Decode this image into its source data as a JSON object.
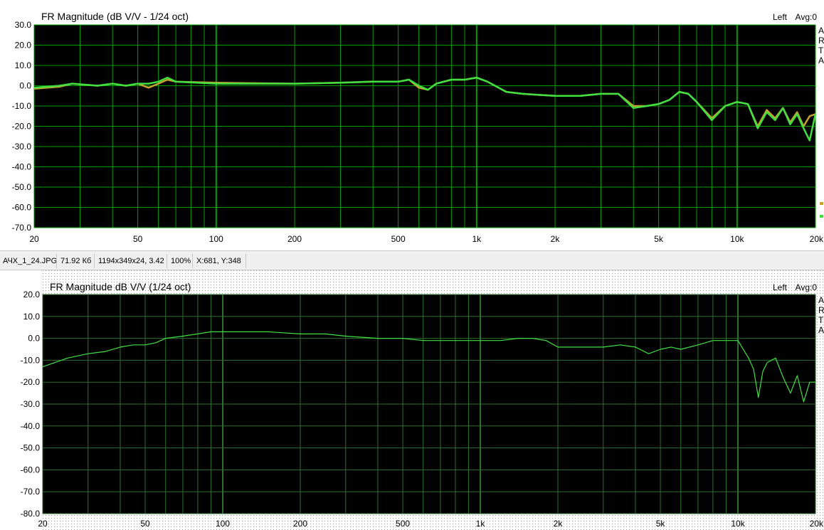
{
  "status_bar": {
    "filename": "АЧХ_1_24.JPG",
    "filesize": "71.92 Кб",
    "dimensions": "1194x349x24, 3.42",
    "zoom": "100%",
    "cursor": "X:681, Y:348"
  },
  "chart_data": [
    {
      "type": "line",
      "title": "FR Magnitude (dB V/V - 1/24 oct)",
      "channel_label": "Left",
      "avg_label": "Avg:0",
      "xlabel": "",
      "ylabel": "",
      "x_scale": "log",
      "xlim": [
        20,
        20000
      ],
      "ylim": [
        -70,
        30
      ],
      "y_ticks": [
        "30.0",
        "20.0",
        "10.0",
        "0.0",
        "-10.0",
        "-20.0",
        "-30.0",
        "-40.0",
        "-50.0",
        "-60.0",
        "-70.0"
      ],
      "x_ticks": [
        {
          "value": 20,
          "label": "20"
        },
        {
          "value": 50,
          "label": "50"
        },
        {
          "value": 100,
          "label": "100"
        },
        {
          "value": 200,
          "label": "200"
        },
        {
          "value": 500,
          "label": "500"
        },
        {
          "value": 1000,
          "label": "1k"
        },
        {
          "value": 2000,
          "label": "2k"
        },
        {
          "value": 5000,
          "label": "5k"
        },
        {
          "value": 10000,
          "label": "10k"
        },
        {
          "value": 20000,
          "label": "20k"
        }
      ],
      "legend_edge_letters": [
        "A",
        "R",
        "T",
        "A"
      ],
      "background": "#000000",
      "grid_color": "#00a000",
      "series": [
        {
          "color": "#c8a030",
          "values": [
            [
              20,
              -1.5
            ],
            [
              25,
              -0.5
            ],
            [
              28,
              1
            ],
            [
              35,
              0
            ],
            [
              40,
              1
            ],
            [
              45,
              0
            ],
            [
              50,
              1
            ],
            [
              55,
              -1
            ],
            [
              60,
              1
            ],
            [
              65,
              3
            ],
            [
              70,
              2
            ],
            [
              100,
              1.5
            ],
            [
              200,
              1
            ],
            [
              300,
              1.5
            ],
            [
              400,
              2
            ],
            [
              500,
              2
            ],
            [
              550,
              3
            ],
            [
              600,
              -1
            ],
            [
              650,
              -2
            ],
            [
              700,
              1
            ],
            [
              800,
              3
            ],
            [
              900,
              3
            ],
            [
              1000,
              4
            ],
            [
              1100,
              2
            ],
            [
              1300,
              -3
            ],
            [
              1500,
              -4
            ],
            [
              2000,
              -5
            ],
            [
              2500,
              -5
            ],
            [
              3000,
              -4
            ],
            [
              3500,
              -4
            ],
            [
              4000,
              -10
            ],
            [
              4500,
              -10
            ],
            [
              5000,
              -9
            ],
            [
              5500,
              -7
            ],
            [
              6000,
              -3
            ],
            [
              6500,
              -4
            ],
            [
              7000,
              -8
            ],
            [
              8000,
              -16
            ],
            [
              9000,
              -10
            ],
            [
              10000,
              -8
            ],
            [
              11000,
              -9
            ],
            [
              12000,
              -20
            ],
            [
              13000,
              -12
            ],
            [
              14000,
              -16
            ],
            [
              15000,
              -11
            ],
            [
              16000,
              -18
            ],
            [
              17000,
              -13
            ],
            [
              18000,
              -20
            ],
            [
              19000,
              -15
            ],
            [
              20000,
              -14
            ]
          ]
        },
        {
          "color": "#40e040",
          "values": [
            [
              20,
              -1
            ],
            [
              25,
              0
            ],
            [
              28,
              1
            ],
            [
              35,
              0
            ],
            [
              40,
              1
            ],
            [
              45,
              0
            ],
            [
              50,
              1
            ],
            [
              55,
              1
            ],
            [
              60,
              2
            ],
            [
              65,
              4
            ],
            [
              70,
              2
            ],
            [
              100,
              1
            ],
            [
              200,
              1
            ],
            [
              300,
              1.5
            ],
            [
              400,
              2
            ],
            [
              500,
              2
            ],
            [
              550,
              3
            ],
            [
              600,
              0
            ],
            [
              650,
              -2
            ],
            [
              700,
              1
            ],
            [
              800,
              3
            ],
            [
              900,
              3
            ],
            [
              1000,
              4
            ],
            [
              1100,
              2
            ],
            [
              1300,
              -3
            ],
            [
              1500,
              -4
            ],
            [
              2000,
              -5
            ],
            [
              2500,
              -5
            ],
            [
              3000,
              -4
            ],
            [
              3500,
              -4
            ],
            [
              4000,
              -11
            ],
            [
              4500,
              -10
            ],
            [
              5000,
              -9
            ],
            [
              5500,
              -7
            ],
            [
              6000,
              -3
            ],
            [
              6500,
              -4
            ],
            [
              7000,
              -8
            ],
            [
              8000,
              -17
            ],
            [
              9000,
              -10
            ],
            [
              10000,
              -8
            ],
            [
              11000,
              -9
            ],
            [
              12000,
              -21
            ],
            [
              13000,
              -13
            ],
            [
              14000,
              -17
            ],
            [
              15000,
              -11
            ],
            [
              16000,
              -19
            ],
            [
              17000,
              -14
            ],
            [
              18000,
              -21
            ],
            [
              19000,
              -27
            ],
            [
              20000,
              -14
            ]
          ]
        }
      ]
    },
    {
      "type": "line",
      "title": "FR Magnitude dB V/V (1/24 oct)",
      "channel_label": "Left",
      "avg_label": "Avg:0",
      "xlabel": "",
      "ylabel": "",
      "x_scale": "log",
      "xlim": [
        20,
        20000
      ],
      "ylim": [
        -80,
        20
      ],
      "y_ticks": [
        "20.0",
        "10.0",
        "0.0",
        "-10.0",
        "-20.0",
        "-30.0",
        "-40.0",
        "-50.0",
        "-60.0",
        "-70.0",
        "-80.0"
      ],
      "x_ticks": [
        {
          "value": 20,
          "label": "20"
        },
        {
          "value": 50,
          "label": "50"
        },
        {
          "value": 100,
          "label": "100"
        },
        {
          "value": 200,
          "label": "200"
        },
        {
          "value": 500,
          "label": "500"
        },
        {
          "value": 1000,
          "label": "1k"
        },
        {
          "value": 2000,
          "label": "2k"
        },
        {
          "value": 5000,
          "label": "5k"
        },
        {
          "value": 10000,
          "label": "10k"
        },
        {
          "value": 20000,
          "label": "20k"
        }
      ],
      "legend_edge_letters": [
        "A",
        "R",
        "T",
        "A"
      ],
      "background": "#000000",
      "grid_color": "#2e6e2e",
      "series": [
        {
          "color": "#40e040",
          "values": [
            [
              20,
              -13
            ],
            [
              25,
              -9
            ],
            [
              30,
              -7
            ],
            [
              35,
              -6
            ],
            [
              40,
              -4
            ],
            [
              45,
              -3
            ],
            [
              50,
              -3
            ],
            [
              55,
              -2
            ],
            [
              60,
              0
            ],
            [
              70,
              1
            ],
            [
              80,
              2
            ],
            [
              90,
              3
            ],
            [
              100,
              3
            ],
            [
              150,
              3
            ],
            [
              200,
              2
            ],
            [
              250,
              2
            ],
            [
              300,
              1
            ],
            [
              400,
              0
            ],
            [
              500,
              0
            ],
            [
              600,
              -1
            ],
            [
              700,
              -1
            ],
            [
              800,
              -1
            ],
            [
              1000,
              -1
            ],
            [
              1200,
              -1
            ],
            [
              1400,
              0
            ],
            [
              1600,
              0
            ],
            [
              1800,
              -1
            ],
            [
              2000,
              -4
            ],
            [
              2500,
              -4
            ],
            [
              3000,
              -4
            ],
            [
              3500,
              -3
            ],
            [
              4000,
              -4
            ],
            [
              4500,
              -7
            ],
            [
              5000,
              -5
            ],
            [
              5500,
              -4
            ],
            [
              6000,
              -5
            ],
            [
              7000,
              -3
            ],
            [
              8000,
              -1
            ],
            [
              9000,
              -1
            ],
            [
              10000,
              -1
            ],
            [
              11000,
              -9
            ],
            [
              11500,
              -14
            ],
            [
              12000,
              -27
            ],
            [
              12500,
              -15
            ],
            [
              13000,
              -11
            ],
            [
              14000,
              -9
            ],
            [
              15000,
              -18
            ],
            [
              16000,
              -25
            ],
            [
              17000,
              -17
            ],
            [
              18000,
              -29
            ],
            [
              19000,
              -20
            ],
            [
              20000,
              -20
            ]
          ]
        }
      ]
    }
  ]
}
